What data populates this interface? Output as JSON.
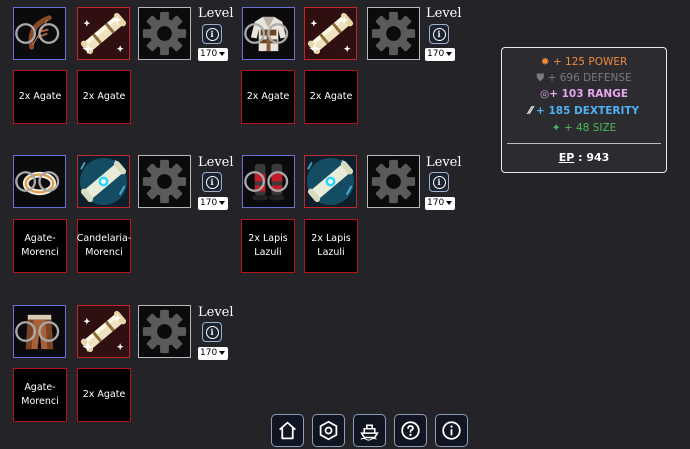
{
  "level_label": "Level",
  "info_button": "i",
  "level_options": [
    "170"
  ],
  "slots": [
    {
      "id": "slot1",
      "item_icon": "bow-icon",
      "scroll_icon": "scroll-icon",
      "gear_icon": "gear-icon",
      "level": "170",
      "gems": [
        "2x Agate",
        "2x Agate"
      ]
    },
    {
      "id": "slot2",
      "item_icon": "chest-armor-icon",
      "scroll_icon": "scroll-icon",
      "gear_icon": "gear-icon",
      "level": "170",
      "gems": [
        "2x Agate",
        "2x Agate"
      ]
    },
    {
      "id": "slot3",
      "item_icon": "ring-icon",
      "scroll_icon": "enchanted-scroll-icon",
      "gear_icon": "gear-icon",
      "level": "170",
      "gems": [
        "Agate-Morenci",
        "Candelaria-Morenci"
      ]
    },
    {
      "id": "slot4",
      "item_icon": "boots-icon",
      "scroll_icon": "enchanted-scroll-icon",
      "gear_icon": "gear-icon",
      "level": "170",
      "gems": [
        "2x Lapis Lazuli",
        "2x Lapis Lazuli"
      ]
    },
    {
      "id": "slot5",
      "item_icon": "leg-armor-icon",
      "scroll_icon": "scroll-icon",
      "gear_icon": "gear-icon",
      "level": "170",
      "gems": [
        "Agate-Morenci",
        "2x Agate"
      ]
    }
  ],
  "stats": [
    {
      "icon": "power-icon",
      "text": "+ 125 POWER",
      "color": "#f08a3c"
    },
    {
      "icon": "shield-icon",
      "text": "+ 696 DEFENSE",
      "color": "#7b7b7b"
    },
    {
      "icon": "range-icon",
      "text": "+ 103 RANGE",
      "color": "#e6a6f0"
    },
    {
      "icon": "dexterity-icon",
      "text": "+ 185 DEXTERITY",
      "color": "#4fb1f2"
    },
    {
      "icon": "size-icon",
      "text": "+ 48 SIZE",
      "color": "#4cb85a"
    }
  ],
  "ep": {
    "label": "EP",
    "value": "943"
  },
  "nav": [
    "home-icon",
    "settings-hex-icon",
    "ship-icon",
    "help-icon",
    "info-icon"
  ]
}
